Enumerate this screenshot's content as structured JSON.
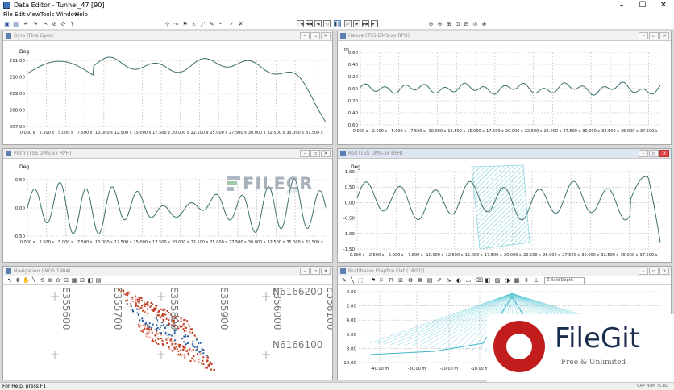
{
  "window": {
    "title": "Data Editor - Tunnel_47 [90]",
    "controls": [
      "–",
      "☐",
      "✕"
    ]
  },
  "menu": [
    "File",
    "Edit",
    "View",
    "Tools",
    "Window",
    "Help"
  ],
  "panels": {
    "gyro": {
      "title": "Gyro (Fine Gyro)",
      "ylabel": "Deg",
      "yticks": [
        "211.00",
        "210.00",
        "209.00",
        "208.00",
        "207.00"
      ],
      "xticks": [
        "0.000 s",
        "2.500 s",
        "5.000 s",
        "7.500 s",
        "10.000 s",
        "12.500 s",
        "15.000 s",
        "17.500 s",
        "20.000 s",
        "22.500 s",
        "25.000 s",
        "27.500 s",
        "30.000 s",
        "32.500 s",
        "35.000 s",
        "37.500 s"
      ]
    },
    "heave": {
      "title": "Heave (TSS DMS-xx RPH)",
      "ylabel": "m",
      "yticks": [
        "0.60",
        "0.40",
        "0.20",
        "0.00",
        "-0.20",
        "-0.40",
        "-0.60"
      ],
      "xticks": [
        "0.000 s",
        "2.500 s",
        "5.000 s",
        "7.500 s",
        "10.000 s",
        "12.500 s",
        "15.000 s",
        "17.500 s",
        "20.000 s",
        "22.500 s",
        "25.000 s",
        "27.500 s",
        "30.000 s",
        "32.500 s",
        "35.000 s",
        "37.500 s"
      ]
    },
    "pitch": {
      "title": "Pitch (TSS DMS-xx RPH)",
      "ylabel": "Deg",
      "yticks": [
        "0.50",
        "0.00",
        "-0.50"
      ],
      "xticks": [
        "0.000 s",
        "2.500 s",
        "5.000 s",
        "7.500 s",
        "10.000 s",
        "12.500 s",
        "15.000 s",
        "17.500 s",
        "20.000 s",
        "22.500 s",
        "25.000 s",
        "27.500 s",
        "30.000 s",
        "32.500 s",
        "35.000 s",
        "37.500 s"
      ]
    },
    "roll": {
      "title": "Roll (TSS DMS-xx RPH)",
      "ylabel": "Deg",
      "yticks": [
        "1.00",
        "0.50",
        "0.00",
        "-0.50",
        "-1.00",
        "-1.50"
      ],
      "xticks": [
        "0.000 s",
        "2.500 s",
        "5.000 s",
        "7.500 s",
        "10.000 s",
        "12.500 s",
        "15.000 s",
        "17.500 s",
        "20.000 s",
        "22.500 s",
        "25.000 s",
        "27.500 s",
        "30.000 s",
        "32.500 s",
        "35.000 s",
        "37.500 s"
      ]
    },
    "navigation": {
      "title": "Navigation (WGS 1984)",
      "eastings": [
        "E355600",
        "E355700",
        "E355800",
        "E355900",
        "E356000",
        "E356100"
      ],
      "northings": [
        "N6166200",
        "N6166100"
      ]
    },
    "multibeam": {
      "title": "Multibeam (Sapfire Flat (1800))",
      "depth_select": "Z Bold Depth",
      "yticks": [
        "0.00",
        "2.00",
        "4.00",
        "6.00",
        "8.00",
        "10.00"
      ],
      "xticks": [
        "-40.00 m",
        "-30.00 m",
        "-20.00 m",
        "-10.00 m"
      ]
    }
  },
  "status": {
    "text": "For Help, press F1",
    "right": "CAP NUM SCRL"
  },
  "watermarks": {
    "filecr": "FILECR",
    "filecr_sub": ".com",
    "filegit": "FileGit",
    "filegit_tag": "Free & Unlimited"
  },
  "colors": {
    "trace": "#3a6f6f",
    "grid": "#b4b4b4",
    "hatch": "#7fd0d6",
    "multibeam": "#5bc8d6",
    "pointcloud_red": "#c0391f",
    "pointcloud_blue": "#2a5f9a"
  }
}
